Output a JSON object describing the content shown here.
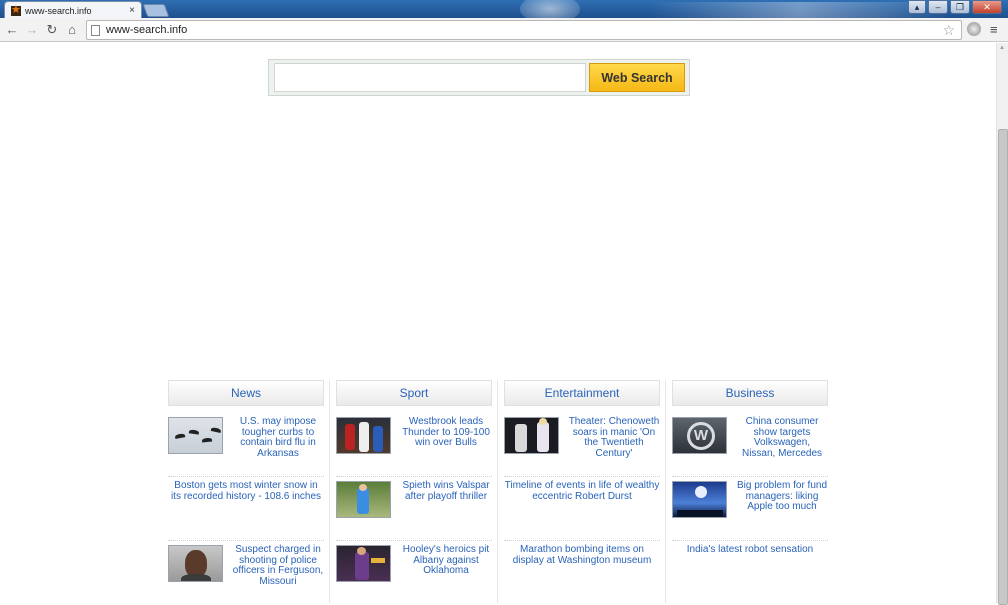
{
  "browser": {
    "tab_title": "www-search.info",
    "tab_close": "×",
    "url": "www-search.info",
    "menu_glyph": "≡",
    "star_glyph": "☆",
    "window_buttons": [
      "▴",
      "–",
      "❐",
      "✕"
    ]
  },
  "nav": {
    "back": "←",
    "forward": "→",
    "reload": "↻",
    "home": "⌂"
  },
  "search": {
    "query": "",
    "button_label": "Web Search"
  },
  "news": {
    "columns": [
      {
        "header": "News",
        "items": [
          {
            "text": "U.S. may impose tougher curbs to contain bird flu in Arkansas",
            "thumb": "birds-in-flight"
          },
          {
            "text": "Boston gets most winter snow in its recorded history - 108.6 inches",
            "thumb": null
          },
          {
            "text": "Suspect charged in shooting of police officers in Ferguson, Missouri",
            "thumb": "suspect-portrait"
          }
        ]
      },
      {
        "header": "Sport",
        "items": [
          {
            "text": "Westbrook leads Thunder to 109-100 win over Bulls",
            "thumb": "basketball-game"
          },
          {
            "text": "Spieth wins Valspar after playoff thriller",
            "thumb": "golfer"
          },
          {
            "text": "Hooley's heroics pit Albany against Oklahoma",
            "thumb": "basketball-player"
          }
        ]
      },
      {
        "header": "Entertainment",
        "items": [
          {
            "text": "Theater: Chenoweth soars in manic 'On the Twentieth Century'",
            "thumb": "theater-stage"
          },
          {
            "text": "Timeline of events in life of wealthy eccentric Robert Durst",
            "thumb": null
          },
          {
            "text": "Marathon bombing items on display at Washington museum",
            "thumb": null
          }
        ]
      },
      {
        "header": "Business",
        "items": [
          {
            "text": "China consumer show targets Volkswagen, Nissan, Mercedes",
            "thumb": "volkswagen-logo"
          },
          {
            "text": "Big problem for fund managers: liking Apple too much",
            "thumb": "apple-event"
          },
          {
            "text": "India's latest robot sensation",
            "thumb": null
          }
        ]
      }
    ]
  },
  "colors": {
    "link": "#2a63b8",
    "search_button": "#f6b816",
    "titlebar": "#1e4f8d"
  }
}
